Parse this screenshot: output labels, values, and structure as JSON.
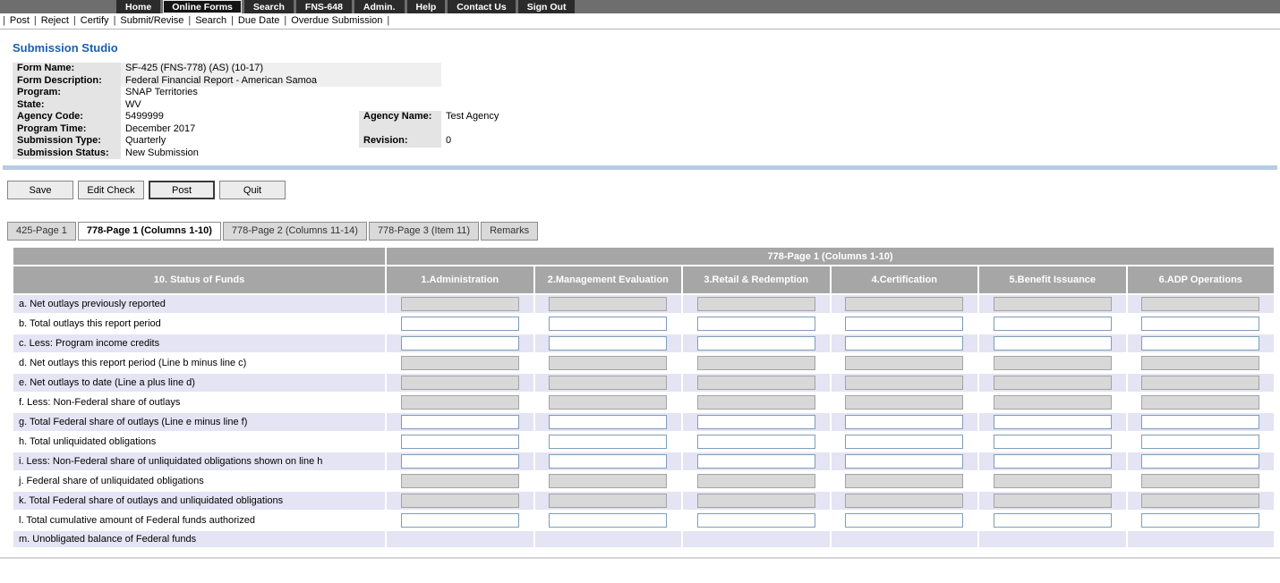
{
  "colors": {
    "nav_bar": "#6e6e6e",
    "nav_item": "#2b2b2b",
    "title_blue": "#1a60b0",
    "header_gray": "#a6a6a6",
    "row_lavender": "#e4e4f4",
    "blue_rule": "#b7cbe3",
    "input_border": "#7f9db9"
  },
  "topnav": {
    "items": [
      {
        "label": "Home",
        "active": false
      },
      {
        "label": "Online Forms",
        "active": true
      },
      {
        "label": "Search",
        "active": false
      },
      {
        "label": "FNS-648",
        "active": false
      },
      {
        "label": "Admin.",
        "active": false
      },
      {
        "label": "Help",
        "active": false
      },
      {
        "label": "Contact Us",
        "active": false
      },
      {
        "label": "Sign Out",
        "active": false
      }
    ]
  },
  "menubar": {
    "items": [
      "Post",
      "Reject",
      "Certify",
      "Submit/Revise",
      "Search",
      "Due Date",
      "Overdue Submission"
    ]
  },
  "page_title": "Submission Studio",
  "details": {
    "rows": [
      {
        "label": "Form Name:",
        "value": "SF-425 (FNS-778) (AS) (10-17)",
        "shaded": true
      },
      {
        "label": "Form Description:",
        "value": "Federal Financial Report - American Samoa",
        "shaded": true
      },
      {
        "label": "Program:",
        "value": "SNAP Territories"
      },
      {
        "label": "State:",
        "value": "WV"
      },
      {
        "label": "Agency Code:",
        "value": "5499999",
        "label2": "Agency Name:",
        "value2": "Test Agency"
      },
      {
        "label": "Program Time:",
        "value": "December 2017",
        "label2": "",
        "value2": ""
      },
      {
        "label": "Submission Type:",
        "value": "Quarterly",
        "label2": "Revision:",
        "value2": "0"
      },
      {
        "label": "Submission Status:",
        "value": "New Submission"
      }
    ]
  },
  "buttons": [
    {
      "label": "Save"
    },
    {
      "label": "Edit Check"
    },
    {
      "label": "Post",
      "default": true
    },
    {
      "label": "Quit"
    }
  ],
  "tabs": [
    {
      "label": "425-Page 1",
      "active": false
    },
    {
      "label": "778-Page 1 (Columns 1-10)",
      "active": true
    },
    {
      "label": "778-Page 2 (Columns 11-14)",
      "active": false
    },
    {
      "label": "778-Page 3 (Item 11)",
      "active": false
    },
    {
      "label": "Remarks",
      "active": false
    }
  ],
  "grid": {
    "title": "778-Page 1 (Columns 1-10)",
    "columns": [
      "10. Status of Funds",
      "1.Administration",
      "2.Management Evaluation",
      "3.Retail & Redemption",
      "4.Certification",
      "5.Benefit Issuance",
      "6.ADP Operations"
    ],
    "input_value": "",
    "rows": [
      {
        "label": "a. Net outlays previously reported",
        "inputs": "disabled"
      },
      {
        "label": "b. Total outlays this report period",
        "inputs": "enabled"
      },
      {
        "label": "c. Less: Program income credits",
        "inputs": "enabled"
      },
      {
        "label": "d. Net outlays this report period (Line b minus line c)",
        "inputs": "disabled"
      },
      {
        "label": "e. Net outlays to date (Line a plus line d)",
        "inputs": "disabled"
      },
      {
        "label": "f. Less: Non-Federal share of outlays",
        "inputs": "disabled"
      },
      {
        "label": "g. Total Federal share of outlays (Line e minus line f)",
        "inputs": "enabled"
      },
      {
        "label": "h. Total unliquidated obligations",
        "inputs": "enabled"
      },
      {
        "label": "i. Less: Non-Federal share of unliquidated obligations shown on line h",
        "inputs": "enabled"
      },
      {
        "label": "j. Federal share of unliquidated obligations",
        "inputs": "disabled"
      },
      {
        "label": "k. Total Federal share of outlays and unliquidated obligations",
        "inputs": "disabled"
      },
      {
        "label": "l. Total cumulative amount of Federal funds authorized",
        "inputs": "enabled"
      },
      {
        "label": "m. Unobligated balance of Federal funds",
        "inputs": "none"
      }
    ]
  }
}
